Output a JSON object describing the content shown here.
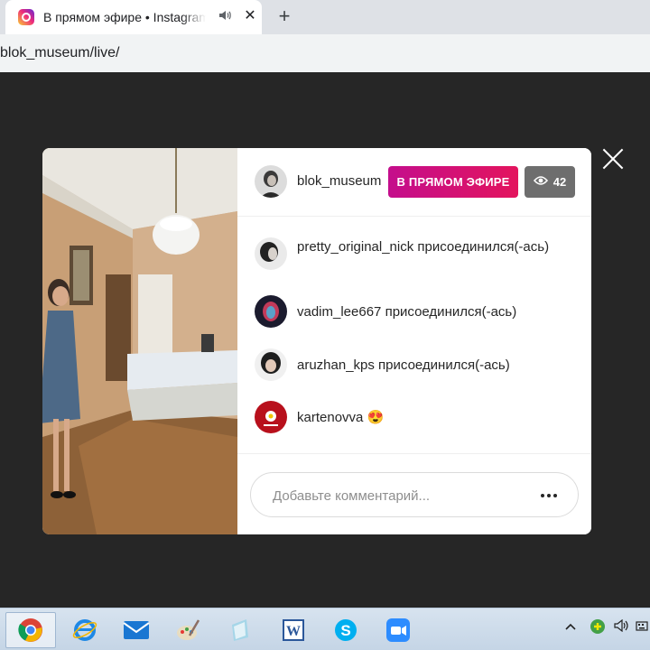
{
  "browser": {
    "tab_title": "В прямом эфире • Instagram",
    "new_tab": "+",
    "close_tab": "✕",
    "url": "blok_museum/live/",
    "favicon": "instagram-icon",
    "audio_icon": "speaker-icon"
  },
  "live": {
    "username": "blok_museum",
    "badge": "В ПРЯМОМ ЭФИРЕ",
    "viewer_count": "42",
    "viewer_icon": "eye-icon",
    "close_icon": "close-icon",
    "badge_colors": [
      "#c40e8c",
      "#e3145d"
    ],
    "comments": [
      {
        "text": "pretty_original_nick присоединился(-ась)"
      },
      {
        "text": "vadim_lee667 присоединился(-ась)"
      },
      {
        "text": "aruzhan_kps присоединился(-ась)"
      },
      {
        "text": "kartenovva 😍"
      }
    ],
    "comment_placeholder": "Добавьте комментарий...",
    "more_icon": "more-dots-icon"
  },
  "taskbar": {
    "apps": [
      "chrome-icon",
      "internet-explorer-icon",
      "mail-icon",
      "paint-icon",
      "notepad-icon",
      "word-icon",
      "skype-icon",
      "zoom-icon"
    ],
    "tray": [
      "chevron-up-icon",
      "network-icon",
      "volume-icon",
      "keyboard-icon"
    ]
  }
}
